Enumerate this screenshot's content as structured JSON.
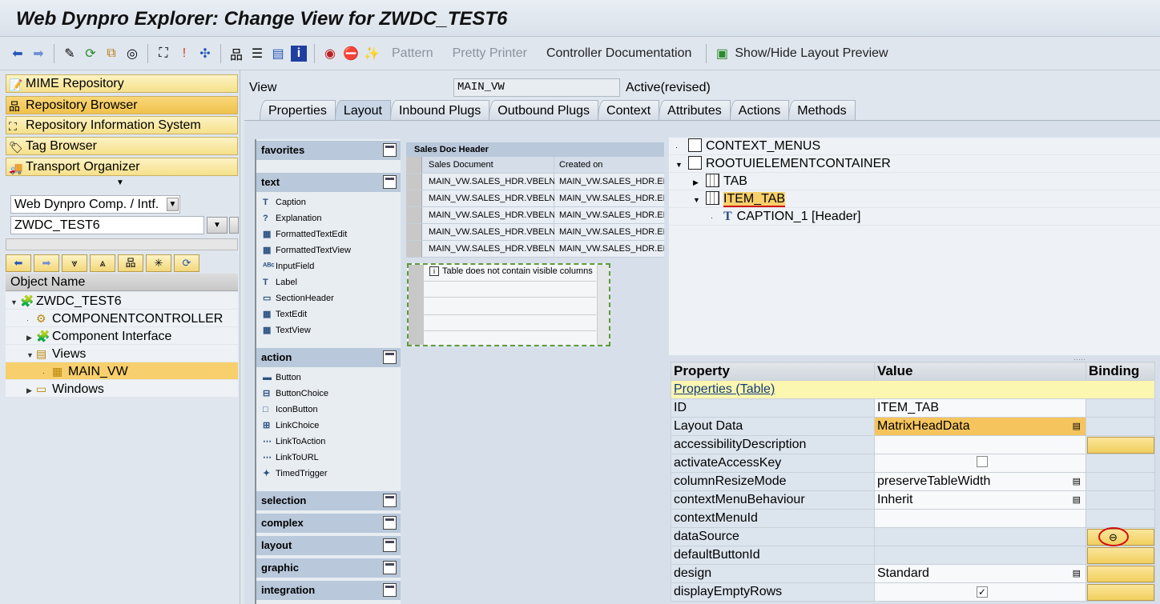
{
  "title": "Web Dynpro Explorer: Change View for ZWDC_TEST6",
  "toolbar": {
    "pattern": "Pattern",
    "pretty_printer": "Pretty Printer",
    "controller_doc": "Controller Documentation",
    "layout_preview": "Show/Hide Layout Preview"
  },
  "nav": {
    "mime": "MIME Repository",
    "browser": "Repository Browser",
    "info": "Repository Information System",
    "tag": "Tag Browser",
    "transport": "Transport Organizer"
  },
  "object_type": "Web Dynpro Comp. / Intf.",
  "object_name": "ZWDC_TEST6",
  "object_header": "Object Name",
  "tree": [
    {
      "label": "ZWDC_TEST6",
      "arrow": "▼",
      "icon": "🧩",
      "indent": 0
    },
    {
      "label": "COMPONENTCONTROLLER",
      "arrow": "·",
      "icon": "⚙",
      "indent": 1
    },
    {
      "label": "Component Interface",
      "arrow": "▶",
      "icon": "🧩",
      "indent": 1
    },
    {
      "label": "Views",
      "arrow": "▼",
      "icon": "▤",
      "indent": 1
    },
    {
      "label": "MAIN_VW",
      "arrow": "·",
      "icon": "▦",
      "indent": 2,
      "selected": true
    },
    {
      "label": "Windows",
      "arrow": "▶",
      "icon": "▭",
      "indent": 1
    }
  ],
  "view": {
    "label": "View",
    "name": "MAIN_VW",
    "status": "Active(revised)"
  },
  "tabs": [
    "Properties",
    "Layout",
    "Inbound Plugs",
    "Outbound Plugs",
    "Context",
    "Attributes",
    "Actions",
    "Methods"
  ],
  "active_tab": 1,
  "palette": {
    "favorites": "favorites",
    "text": {
      "title": "text",
      "items": [
        "Caption",
        "Explanation",
        "FormattedTextEdit",
        "FormattedTextView",
        "InputField",
        "Label",
        "SectionHeader",
        "TextEdit",
        "TextView"
      ]
    },
    "action": {
      "title": "action",
      "items": [
        "Button",
        "ButtonChoice",
        "IconButton",
        "LinkChoice",
        "LinkToAction",
        "LinkToURL",
        "TimedTrigger"
      ]
    },
    "collapsed": [
      "selection",
      "complex",
      "layout",
      "graphic",
      "integration"
    ]
  },
  "preview_table": {
    "title": "Sales Doc Header",
    "columns": [
      "Sales Document",
      "Created on"
    ],
    "rows": [
      [
        "MAIN_VW.SALES_HDR.VBELN",
        "MAIN_VW.SALES_HDR.ER"
      ],
      [
        "MAIN_VW.SALES_HDR.VBELN",
        "MAIN_VW.SALES_HDR.ER"
      ],
      [
        "MAIN_VW.SALES_HDR.VBELN",
        "MAIN_VW.SALES_HDR.ER"
      ],
      [
        "MAIN_VW.SALES_HDR.VBELN",
        "MAIN_VW.SALES_HDR.ER"
      ],
      [
        "MAIN_VW.SALES_HDR.VBELN",
        "MAIN_VW.SALES_HDR.ER"
      ]
    ],
    "empty_msg": "Table does not contain visible columns"
  },
  "ui_tree": [
    {
      "label": "CONTEXT_MENUS",
      "arrow": "·",
      "icon": "box",
      "indent": 0
    },
    {
      "label": "ROOTUIELEMENTCONTAINER",
      "arrow": "▼",
      "icon": "box",
      "indent": 0
    },
    {
      "label": "TAB",
      "arrow": "▶",
      "icon": "grid",
      "indent": 1
    },
    {
      "label": "ITEM_TAB",
      "arrow": "▼",
      "icon": "grid",
      "indent": 1,
      "selected": true
    },
    {
      "label": "CAPTION_1  [Header]",
      "arrow": "·",
      "icon": "T",
      "indent": 2
    }
  ],
  "props": {
    "headers": [
      "Property",
      "Value",
      "Binding"
    ],
    "section": "Properties (Table)",
    "rows": [
      {
        "p": "ID",
        "v": "ITEM_TAB"
      },
      {
        "p": "Layout Data",
        "v": "MatrixHeadData",
        "dd": true,
        "hl": true
      },
      {
        "p": "accessibilityDescription",
        "v": "",
        "bind": true
      },
      {
        "p": "activateAccessKey",
        "v": "",
        "chk": "unchecked"
      },
      {
        "p": "columnResizeMode",
        "v": "preserveTableWidth",
        "dd": true
      },
      {
        "p": "contextMenuBehaviour",
        "v": "Inherit",
        "dd": true
      },
      {
        "p": "contextMenuId",
        "v": ""
      },
      {
        "p": "dataSource",
        "v": "",
        "bind": true,
        "grey": true
      },
      {
        "p": "defaultButtonId",
        "v": "",
        "bind": true,
        "grey": true
      },
      {
        "p": "design",
        "v": "Standard",
        "dd": true,
        "bind": true
      },
      {
        "p": "displayEmptyRows",
        "v": "",
        "chk": "checked",
        "bind": true
      }
    ]
  }
}
